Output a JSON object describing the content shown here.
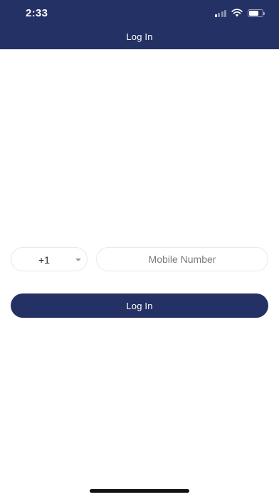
{
  "status_bar": {
    "time": "2:33",
    "icons": [
      "signal-icon",
      "wifi-icon",
      "battery-icon"
    ]
  },
  "header": {
    "title": "Log In"
  },
  "form": {
    "country_code": "+1",
    "mobile_placeholder": "Mobile Number",
    "mobile_value": "",
    "login_label": "Log In"
  },
  "colors": {
    "brand": "#243164",
    "background": "#ffffff",
    "border": "#e8e8ec"
  }
}
